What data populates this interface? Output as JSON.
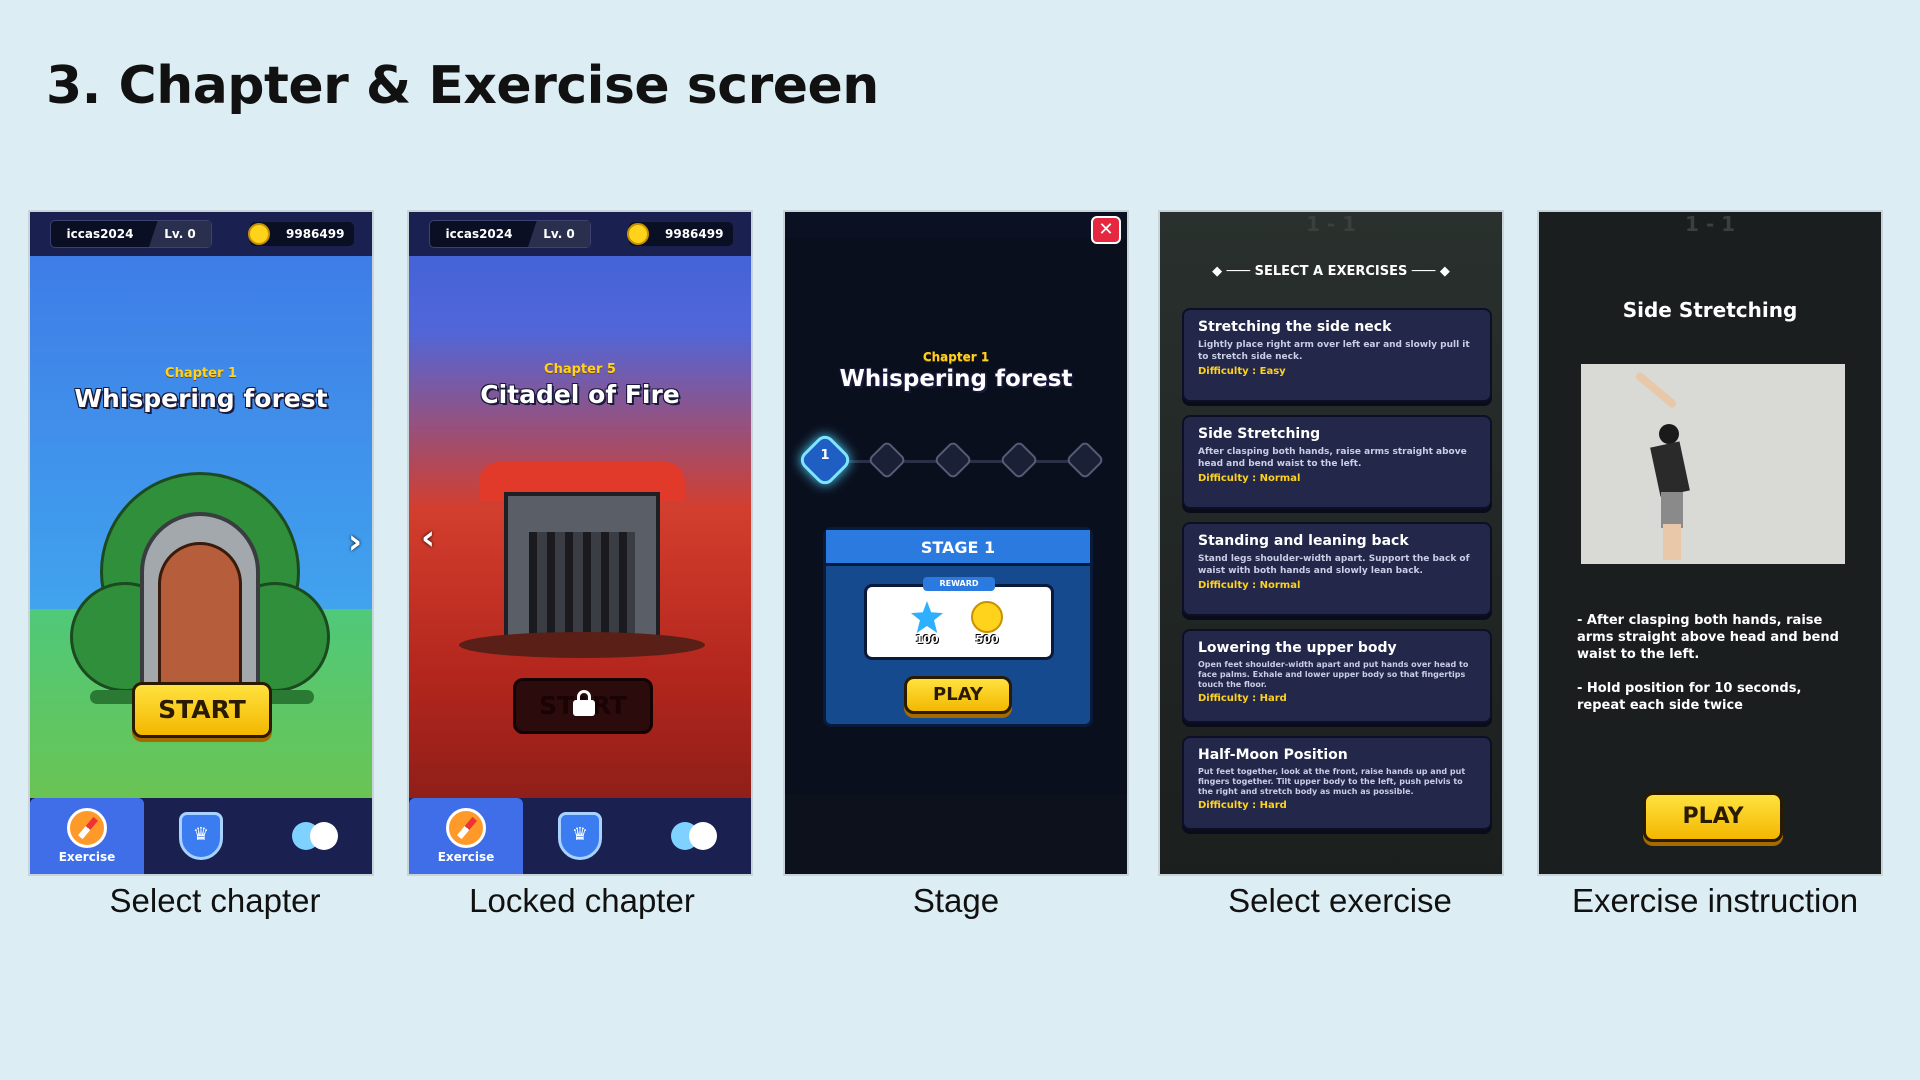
{
  "page_title": "3. Chapter & Exercise screen",
  "captions": [
    "Select chapter",
    "Locked chapter",
    "Stage",
    "Select exercise",
    "Exercise instruction"
  ],
  "topbar": {
    "username": "iccas2024",
    "level": "Lv. 0",
    "coins": "9986499"
  },
  "nav": {
    "exercise_label": "Exercise"
  },
  "chapter1": {
    "sub": "Chapter 1",
    "title": "Whispering forest",
    "start": "START"
  },
  "chapter5": {
    "sub": "Chapter 5",
    "title": "Citadel of Fire",
    "start": "START"
  },
  "stage": {
    "sub": "Chapter 1",
    "title": "Whispering forest",
    "current_node": "1",
    "header": "STAGE 1",
    "reward_label": "REWARD",
    "reward_star": "100",
    "reward_coin": "500",
    "play": "PLAY"
  },
  "select_exercise": {
    "header": "SELECT A EXERCISES",
    "level_tag": "1 - 1",
    "exercises": [
      {
        "title": "Stretching the side neck",
        "desc": "Lightly place right arm over left ear and slowly pull it to stretch side neck.",
        "difficulty": "Difficulty : Easy"
      },
      {
        "title": "Side Stretching",
        "desc": "After clasping both hands, raise arms straight above head and bend waist to the left.",
        "difficulty": "Difficulty : Normal"
      },
      {
        "title": "Standing and leaning back",
        "desc": "Stand legs shoulder-width apart. Support the back of waist with both hands and slowly lean back.",
        "difficulty": "Difficulty : Normal"
      },
      {
        "title": "Lowering the upper body",
        "desc": "Open feet shoulder-width apart and put hands over head to face palms. Exhale and lower upper body so that fingertips touch the floor.",
        "difficulty": "Difficulty : Hard"
      },
      {
        "title": "Half-Moon Position",
        "desc": "Put feet together, look at the front, raise hands up and put fingers together. Tilt upper body to the left, push pelvis to the right and stretch body as much as possible.",
        "difficulty": "Difficulty : Hard"
      }
    ]
  },
  "instruction": {
    "level_tag": "1 - 1",
    "title": "Side Stretching",
    "step1": "- After clasping both hands, raise arms straight above head and bend waist to the left.",
    "step2": "- Hold position for 10 seconds, repeat each side twice",
    "play": "PLAY"
  }
}
